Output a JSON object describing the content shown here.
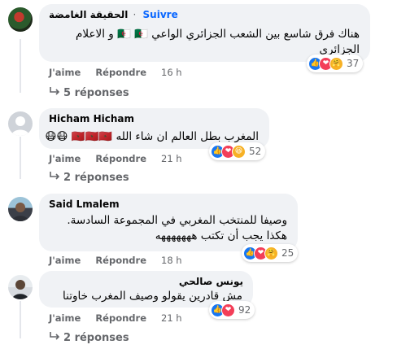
{
  "actions": {
    "like": "J'aime",
    "reply": "Répondre"
  },
  "comments": [
    {
      "author": "الحقيقة الغامضة",
      "follow": "Suivre",
      "text": [
        "هناك فرق شاسع بين الشعب الجزائري الواعي 🇩🇿 🇩🇿 و الاعلام",
        "الجزائرى"
      ],
      "time": "16 h",
      "reactions_count": "37",
      "replies": "5 réponses"
    },
    {
      "author": "Hicham Hicham",
      "text": [
        "المغرب بطل العالم ان شاء الله 🇲🇦🇲🇦🇲🇦 😷😷"
      ],
      "time": "21 h",
      "reactions_count": "52",
      "replies": "2 réponses"
    },
    {
      "author": "Said Lmalem",
      "text": [
        "وصيفا للمنتخب المغربي في المجموعة السادسة.",
        "هكذا يجب أن تكتب هههههههه"
      ],
      "time": "18 h",
      "reactions_count": "25"
    },
    {
      "author": "يونس صالحي",
      "text": [
        "مش قادرين يقولو وصيف المغرب خاوتنا"
      ],
      "time": "21 h",
      "reactions_count": "92",
      "replies": "2 réponses"
    }
  ],
  "colors": {
    "bubble": "#f0f2f5",
    "link": "#0866ff",
    "meta": "#65676b",
    "like": "#1877f2",
    "love": "#f33e58",
    "haha": "#f7b125"
  }
}
